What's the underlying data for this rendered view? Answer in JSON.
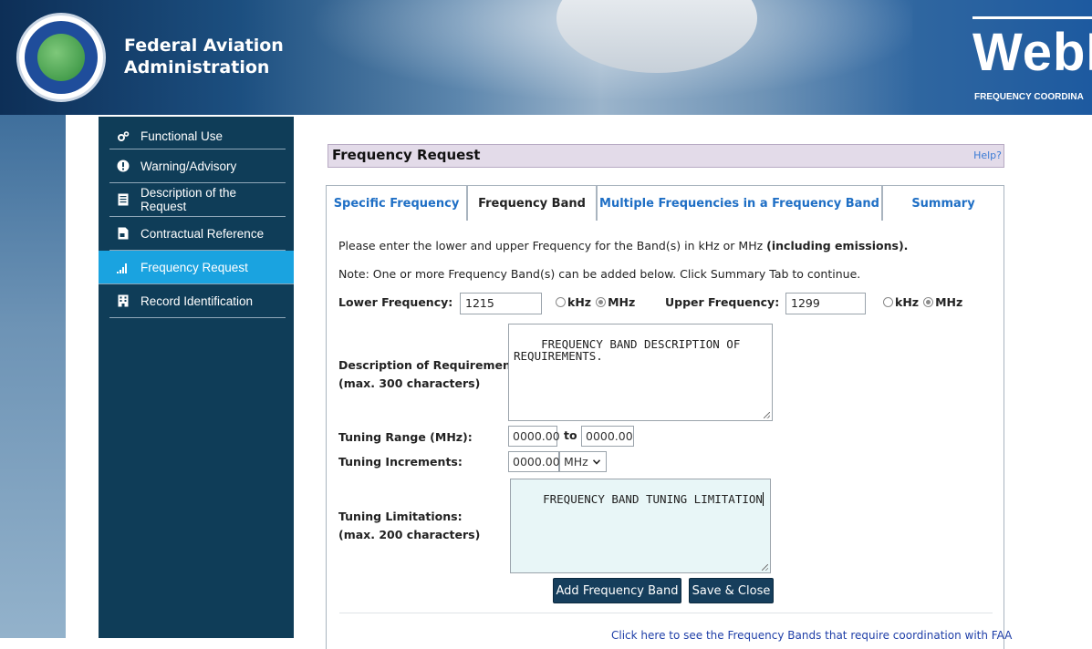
{
  "header": {
    "org_name": "Federal Aviation\nAdministration",
    "product": "WebF",
    "product_sub": "FREQUENCY COORDINA"
  },
  "sidebar": {
    "items": [
      {
        "label": "Functional Use",
        "icon": "gears-icon"
      },
      {
        "label": "Warning/Advisory",
        "icon": "exclamation-icon"
      },
      {
        "label": "Description of the Request",
        "icon": "document-icon"
      },
      {
        "label": "Contractual Reference",
        "icon": "contract-icon"
      },
      {
        "label": "Frequency Request",
        "icon": "signal-bars-icon",
        "active": true
      },
      {
        "label": "Record Identification",
        "icon": "building-icon"
      }
    ]
  },
  "panel": {
    "title": "Frequency Request",
    "help": "Help?"
  },
  "tabs": [
    {
      "label": "Specific Frequency"
    },
    {
      "label": "Frequency Band",
      "active": true
    },
    {
      "label": "Multiple Frequencies in a Frequency Band"
    },
    {
      "label": "Summary"
    }
  ],
  "form": {
    "intro": "Please enter the lower and upper Frequency for the Band(s) in kHz or MHz",
    "intro_bold": "(including emissions).",
    "note": "Note: One or more Frequency Band(s) can be added below. Click Summary Tab to continue.",
    "lower_label": "Lower Frequency:",
    "lower_value": "1215",
    "upper_label": "Upper Frequency:",
    "upper_value": "1299",
    "unit_khz": "kHz",
    "unit_mhz": "MHz",
    "lower_unit_selected": "MHz",
    "upper_unit_selected": "MHz",
    "desc_label": "Description of Requirement:",
    "desc_sublabel": "(max. 300 characters)",
    "desc_value": "FREQUENCY BAND DESCRIPTION OF\nREQUIREMENTS.",
    "tuning_range_label": "Tuning Range (MHz):",
    "tuning_from": "0000.00",
    "tuning_to_label": "to",
    "tuning_to": "0000.00",
    "tuning_inc_label": "Tuning Increments:",
    "tuning_inc_value": "0000.00",
    "tuning_inc_unit": "MHz",
    "limit_label": "Tuning Limitations:",
    "limit_sublabel": "(max. 200 characters)",
    "limit_value": "FREQUENCY BAND TUNING LIMITATION",
    "add_button": "Add Frequency Band",
    "save_button": "Save & Close",
    "bottom_link": "Click here to see the Frequency Bands that require coordination with FAA"
  },
  "colors": {
    "sidebar_bg": "#0f3d58",
    "active_item": "#1aa3e0",
    "button_bg": "#163e5c",
    "panel_head": "#e3dbe9",
    "link": "#1f6fc5"
  }
}
